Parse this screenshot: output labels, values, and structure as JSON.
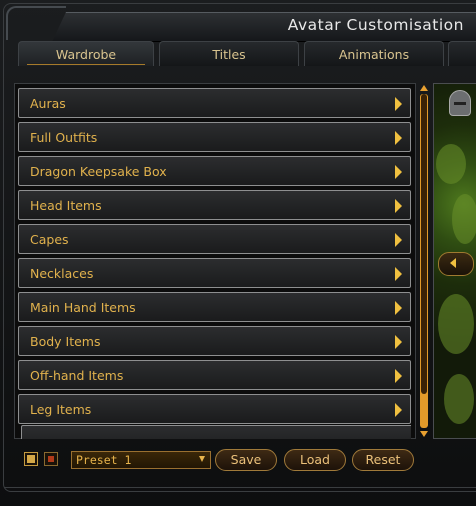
{
  "window": {
    "title": "Avatar Customisation"
  },
  "tabs": [
    {
      "label": "Wardrobe",
      "active": true
    },
    {
      "label": "Titles",
      "active": false
    },
    {
      "label": "Animations",
      "active": false
    },
    {
      "label": "",
      "active": false
    }
  ],
  "categories": [
    {
      "label": "Auras"
    },
    {
      "label": "Full Outfits"
    },
    {
      "label": "Dragon Keepsake Box"
    },
    {
      "label": "Head Items"
    },
    {
      "label": "Capes"
    },
    {
      "label": "Necklaces"
    },
    {
      "label": "Main Hand Items"
    },
    {
      "label": "Body Items"
    },
    {
      "label": "Off-hand Items"
    },
    {
      "label": "Leg Items"
    }
  ],
  "preset": {
    "selected": "Preset 1"
  },
  "buttons": {
    "save": "Save",
    "load": "Load",
    "reset": "Reset"
  },
  "colors": {
    "accent": "#e1b24d",
    "arrow": "#f0c040",
    "scroll": "#e29a2a"
  }
}
